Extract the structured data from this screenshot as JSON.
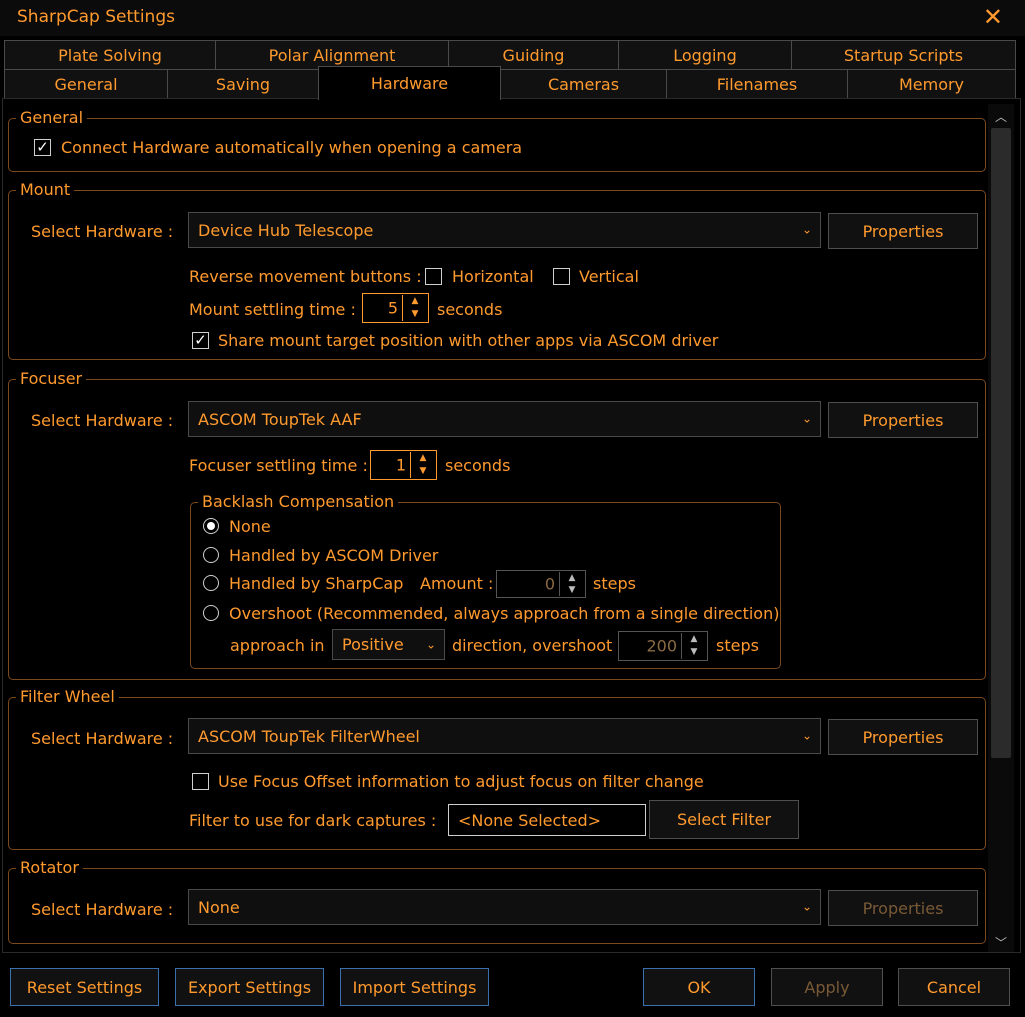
{
  "window": {
    "title": "SharpCap Settings"
  },
  "tabs": {
    "row1": [
      "Plate Solving",
      "Polar Alignment",
      "Guiding",
      "Logging",
      "Startup Scripts"
    ],
    "row2": [
      "General",
      "Saving",
      "Hardware",
      "Cameras",
      "Filenames",
      "Memory"
    ],
    "active": "Hardware"
  },
  "general_group": {
    "legend": "General",
    "connect_auto": {
      "label": "Connect Hardware automatically when opening a camera",
      "checked": true
    }
  },
  "mount": {
    "legend": "Mount",
    "select_label": "Select Hardware :",
    "selected": "Device Hub Telescope",
    "properties_label": "Properties",
    "reverse_label": "Reverse movement buttons :",
    "horizontal_label": "Horizontal",
    "vertical_label": "Vertical",
    "settling_label": "Mount settling time :",
    "settling_value": "5",
    "seconds_label": "seconds",
    "share_label": "Share mount target position with other apps via ASCOM driver",
    "share_checked": true
  },
  "focuser": {
    "legend": "Focuser",
    "select_label": "Select Hardware :",
    "selected": "ASCOM ToupTek AAF",
    "properties_label": "Properties",
    "settling_label": "Focuser settling time :",
    "settling_value": "1",
    "seconds_label": "seconds",
    "backlash": {
      "legend": "Backlash Compensation",
      "none_label": "None",
      "ascom_label": "Handled by ASCOM Driver",
      "sharpcap_label": "Handled by SharpCap",
      "amount_label": "Amount :",
      "amount_value": "0",
      "steps_label": "steps",
      "overshoot_label": "Overshoot (Recommended, always approach from a single direction)",
      "approach_label": "approach in",
      "direction_value": "Positive",
      "direction_overshoot_label": "direction, overshoot",
      "overshoot_value": "200",
      "overshoot_steps_label": "steps",
      "selected": "None"
    }
  },
  "filter_wheel": {
    "legend": "Filter Wheel",
    "select_label": "Select Hardware :",
    "selected": "ASCOM ToupTek FilterWheel",
    "properties_label": "Properties",
    "focus_offset_label": "Use Focus Offset information to adjust focus on filter change",
    "dark_label": "Filter to use for dark captures :",
    "dark_value": "<None Selected>",
    "select_filter_label": "Select Filter"
  },
  "rotator": {
    "legend": "Rotator",
    "select_label": "Select Hardware :",
    "selected": "None",
    "properties_label": "Properties"
  },
  "footer": {
    "reset_label": "Reset Settings",
    "export_label": "Export Settings",
    "import_label": "Import Settings",
    "ok_label": "OK",
    "apply_label": "Apply",
    "cancel_label": "Cancel"
  },
  "icons": {
    "close": "close-icon",
    "check": "checkmark-icon",
    "dropdown": "chevron-down-icon",
    "spin_up": "arrow-up-icon",
    "spin_down": "arrow-down-icon"
  },
  "colors": {
    "text": "#ff9a2e",
    "background": "#000000",
    "group_border": "#7a4a1c",
    "footer_button_border": "#3a6fb0"
  }
}
